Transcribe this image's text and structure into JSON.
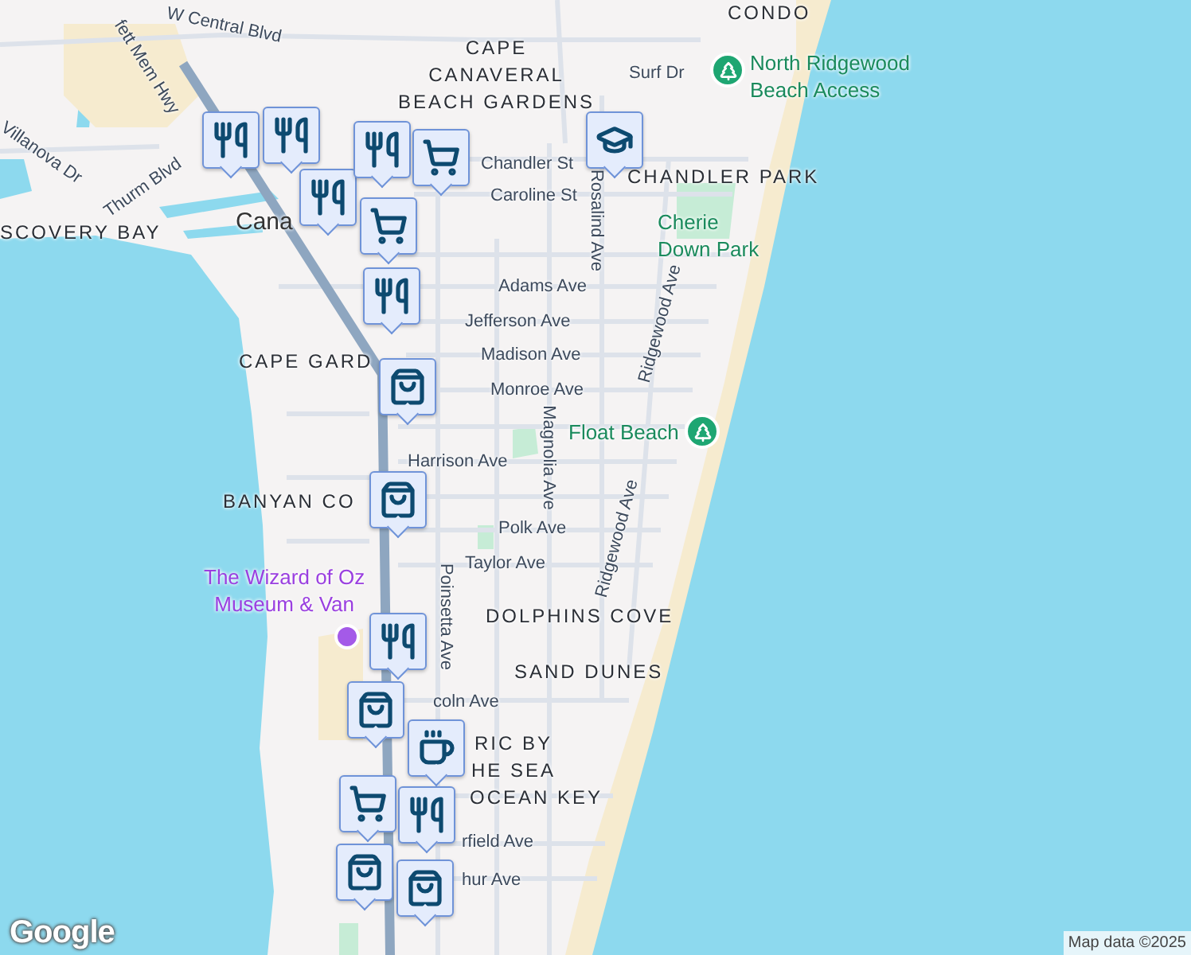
{
  "labels": [
    {
      "kind": "area",
      "lines": [
        "CONDO"
      ]
    },
    {
      "kind": "street",
      "lines": [
        "fett Mem Hwy"
      ]
    },
    {
      "kind": "street",
      "lines": [
        "W Central Blvd"
      ]
    },
    {
      "kind": "area",
      "lines": [
        "CAPE",
        "CANAVERAL",
        "BEACH GARDENS"
      ]
    },
    {
      "kind": "street",
      "lines": [
        "Surf Dr"
      ]
    },
    {
      "kind": "park",
      "lines": [
        "North Ridgewood",
        "Beach Access"
      ]
    },
    {
      "kind": "street",
      "lines": [
        "Villanova Dr"
      ]
    },
    {
      "kind": "street",
      "lines": [
        "Thurm Blvd"
      ]
    },
    {
      "kind": "street",
      "lines": [
        "Chandler St"
      ]
    },
    {
      "kind": "street",
      "lines": [
        "Caroline St"
      ]
    },
    {
      "kind": "area",
      "lines": [
        "CHANDLER PARK"
      ]
    },
    {
      "kind": "area",
      "lines": [
        "SCOVERY BAY"
      ]
    },
    {
      "kind": "city",
      "lines": [
        "Cana"
      ]
    },
    {
      "kind": "park",
      "lines": [
        "Cherie",
        "Down Park"
      ]
    },
    {
      "kind": "street",
      "lines": [
        "Adams Ave"
      ]
    },
    {
      "kind": "street",
      "lines": [
        "Rosalind Ave"
      ]
    },
    {
      "kind": "street",
      "lines": [
        "Ridgewood Ave"
      ]
    },
    {
      "kind": "street",
      "lines": [
        "Jefferson Ave"
      ]
    },
    {
      "kind": "street",
      "lines": [
        "Madison Ave"
      ]
    },
    {
      "kind": "area",
      "lines": [
        "CAPE GARD"
      ]
    },
    {
      "kind": "street",
      "lines": [
        "Monroe Ave"
      ]
    },
    {
      "kind": "street",
      "lines": [
        "Magnolia Ave"
      ]
    },
    {
      "kind": "park",
      "lines": [
        "Float Beach"
      ]
    },
    {
      "kind": "street",
      "lines": [
        "Harrison Ave"
      ]
    },
    {
      "kind": "area",
      "lines": [
        "BANYAN CO"
      ]
    },
    {
      "kind": "street",
      "lines": [
        "Polk Ave"
      ]
    },
    {
      "kind": "street",
      "lines": [
        "Ridgewood Ave"
      ]
    },
    {
      "kind": "street",
      "lines": [
        "Taylor Ave"
      ]
    },
    {
      "kind": "street",
      "lines": [
        "Poinsetta Ave"
      ]
    },
    {
      "kind": "poi",
      "lines": [
        "The Wizard of Oz",
        "Museum & Van"
      ]
    },
    {
      "kind": "area",
      "lines": [
        "DOLPHINS COVE"
      ]
    },
    {
      "kind": "area",
      "lines": [
        "SAND DUNES"
      ]
    },
    {
      "kind": "street",
      "lines": [
        "coln Ave"
      ]
    },
    {
      "kind": "area",
      "lines": [
        "RIC BY",
        "HE SEA"
      ]
    },
    {
      "kind": "area",
      "lines": [
        "OCEAN KEY"
      ]
    },
    {
      "kind": "street",
      "lines": [
        "rfield Ave"
      ]
    },
    {
      "kind": "street",
      "lines": [
        "hur Ave"
      ]
    }
  ],
  "pins": [
    {
      "kind": "restaurant"
    },
    {
      "kind": "restaurant"
    },
    {
      "kind": "restaurant"
    },
    {
      "kind": "restaurant"
    },
    {
      "kind": "grocery"
    },
    {
      "kind": "grocery"
    },
    {
      "kind": "school"
    },
    {
      "kind": "restaurant"
    },
    {
      "kind": "shopping"
    },
    {
      "kind": "shopping"
    },
    {
      "kind": "restaurant"
    },
    {
      "kind": "shopping"
    },
    {
      "kind": "cafe"
    },
    {
      "kind": "restaurant"
    },
    {
      "kind": "grocery"
    },
    {
      "kind": "shopping"
    },
    {
      "kind": "shopping"
    },
    {
      "kind": "park"
    },
    {
      "kind": "park"
    },
    {
      "kind": "museum"
    }
  ],
  "logo": "Google",
  "attribution": "Map data ©2025"
}
